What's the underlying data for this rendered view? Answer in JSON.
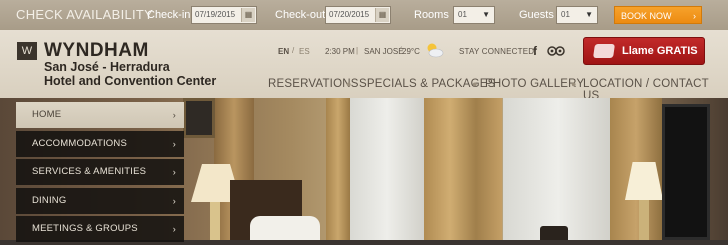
{
  "availability": {
    "title": "CHECK AVAILABILITY",
    "checkin_label": "Check-in",
    "checkin_value": "07/19/2015",
    "checkout_label": "Check-out",
    "checkout_value": "07/20/2015",
    "rooms_label": "Rooms",
    "rooms_value": "01",
    "guests_label": "Guests",
    "guests_value": "01",
    "book_label": "BOOK NOW",
    "book_arrow": "›",
    "calendar_glyph": "▦",
    "select_arrow": "▼"
  },
  "brand": {
    "logo_glyph": "W",
    "name": "WYNDHAM",
    "hotel_line1": "San José - Herradura",
    "hotel_line2": "Hotel and Convention Center"
  },
  "header": {
    "lang_en": "EN",
    "lang_divider": "/",
    "lang_es": "ES",
    "time": "2:30 PM",
    "meta_divider": "|",
    "city": "SAN JOSÉ",
    "temperature": "29°C",
    "stay_connected": "STAY CONNECTED:",
    "facebook_glyph": "f",
    "call_label": "Llame GRATIS"
  },
  "nav": {
    "items": [
      "RESERVATIONS",
      "SPECIALS & PACKAGES",
      "PHOTO GALLERY",
      "LOCATION / CONTACT US"
    ],
    "separator": "●"
  },
  "menu": {
    "chevron": "›",
    "items": [
      {
        "label": "HOME",
        "active": true
      },
      {
        "label": "ACCOMMODATIONS",
        "active": false
      },
      {
        "label": "SERVICES & AMENITIES",
        "active": false
      },
      {
        "label": "DINING",
        "active": false
      },
      {
        "label": "MEETINGS & GROUPS",
        "active": false
      }
    ]
  },
  "colors": {
    "accent_orange": "#f39a1d",
    "call_red": "#b31f1f",
    "header_beige": "#e0d8ca",
    "menu_dark": "#141210"
  }
}
